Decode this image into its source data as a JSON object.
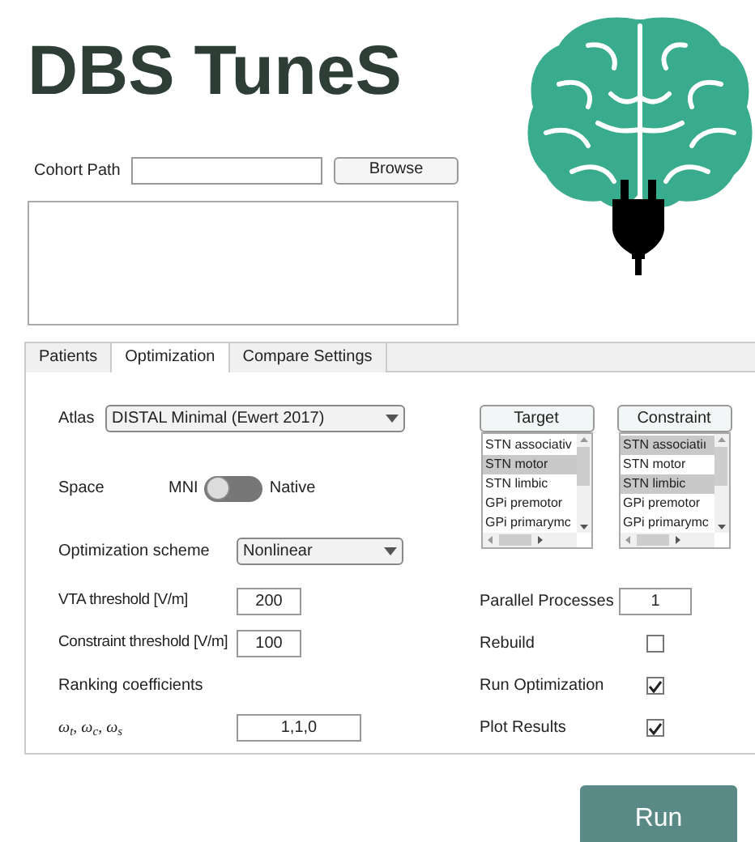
{
  "title": "DBS TuneS",
  "cohort": {
    "label": "Cohort Path",
    "button": "Browse"
  },
  "tabs": [
    {
      "label": "Patients",
      "selected": false
    },
    {
      "label": "Optimization",
      "selected": true
    },
    {
      "label": "Compare Settings",
      "selected": false
    }
  ],
  "atlas": {
    "label": "Atlas",
    "value": "DISTAL Minimal (Ewert 2017)"
  },
  "space": {
    "label": "Space",
    "left": "MNI",
    "right": "Native",
    "native": false
  },
  "scheme": {
    "label": "Optimization scheme",
    "value": "Nonlinear"
  },
  "lists": [
    {
      "button": "Target",
      "items": [
        {
          "label": "STN associativ",
          "selected": false
        },
        {
          "label": "STN motor",
          "selected": true
        },
        {
          "label": "STN limbic",
          "selected": false
        },
        {
          "label": "GPi premotor",
          "selected": false
        },
        {
          "label": "GPi primarymc",
          "selected": false
        }
      ]
    },
    {
      "button": "Constraint",
      "items": [
        {
          "label": "STN associatiı",
          "selected": true
        },
        {
          "label": "STN motor",
          "selected": false
        },
        {
          "label": "STN limbic",
          "selected": true
        },
        {
          "label": "GPi premotor",
          "selected": false
        },
        {
          "label": "GPi primarymc",
          "selected": false
        }
      ]
    }
  ],
  "rows": [
    {
      "left": {
        "kind": "field",
        "label": "VTA threshold [V/m]",
        "value": "200"
      },
      "right": {
        "kind": "field",
        "label": "Parallel Processes",
        "value": "1"
      }
    },
    {
      "left": {
        "kind": "field",
        "label": "Constraint threshold [V/m]",
        "value": "100"
      },
      "right": {
        "kind": "check",
        "label": "Rebuild",
        "checked": false
      }
    },
    {
      "left": {
        "kind": "text",
        "label": "Ranking coefficients"
      },
      "right": {
        "kind": "check",
        "label": "Run Optimization",
        "checked": true
      }
    },
    {
      "left": {
        "kind": "wide",
        "label": "ω$_{t}$, ω$_{c}$, ω$_{s}$",
        "value": "1,1,0"
      },
      "right": {
        "kind": "check",
        "label": "Plot Results",
        "checked": true
      }
    }
  ],
  "run_button": "Run"
}
